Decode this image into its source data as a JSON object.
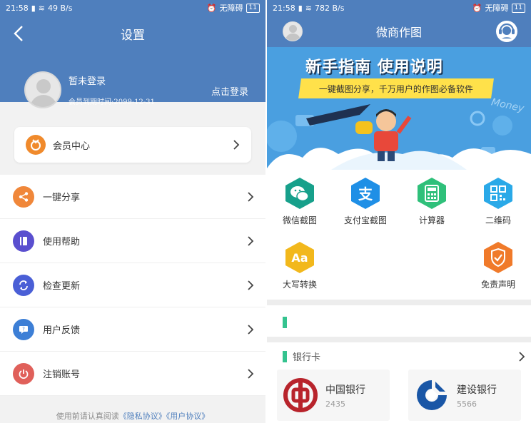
{
  "left": {
    "status": {
      "time": "21:58",
      "speed": "49 B/s",
      "mode": "无障碍",
      "battery": "11"
    },
    "nav": {
      "title": "设置"
    },
    "profile": {
      "name": "暂未登录",
      "expiry": "会员到期时间:2099-12-31",
      "login_link": "点击登录"
    },
    "vip_center": {
      "label": "会员中心"
    },
    "menu": [
      {
        "label": "一键分享",
        "icon": "share-icon",
        "color": "#f0873a"
      },
      {
        "label": "使用帮助",
        "icon": "book-icon",
        "color": "#5a4fcf"
      },
      {
        "label": "检查更新",
        "icon": "refresh-icon",
        "color": "#4a5fd6"
      },
      {
        "label": "用户反馈",
        "icon": "feedback-icon",
        "color": "#3d7fd6"
      },
      {
        "label": "注销账号",
        "icon": "power-icon",
        "color": "#e0605a"
      }
    ],
    "footer": {
      "prefix": "使用前请认真阅读",
      "privacy": "《隐私协议》",
      "user": "《用户协议》"
    }
  },
  "right": {
    "status": {
      "time": "21:58",
      "speed": "782 B/s",
      "mode": "无障碍",
      "battery": "11"
    },
    "header": {
      "title": "微商作图"
    },
    "banner": {
      "title": "新手指南 使用说明",
      "subtitle": "一键截图分享，千万用户的作图必备软件",
      "money": "Money"
    },
    "tools": [
      {
        "label": "微信截图",
        "icon": "wechat-icon",
        "color": "#17a08b"
      },
      {
        "label": "支付宝截图",
        "icon": "alipay-icon",
        "color": "#1f8fe6"
      },
      {
        "label": "计算器",
        "icon": "calculator-icon",
        "color": "#2fc07a"
      },
      {
        "label": "二维码",
        "icon": "qrcode-icon",
        "color": "#2aa9e8"
      },
      {
        "label": "大写转换",
        "icon": "case-convert-icon",
        "color": "#f2b81c",
        "glyph": "Aa"
      },
      {
        "label": "免责声明",
        "icon": "shield-check-icon",
        "color": "#f07a2a"
      }
    ],
    "bank_section": {
      "title": "银行卡",
      "cards": [
        {
          "name": "中国银行",
          "code": "2435",
          "icon": "boc-logo-icon",
          "color": "#b8242c"
        },
        {
          "name": "建设银行",
          "code": "5566",
          "icon": "ccb-logo-icon",
          "color": "#1956a6"
        }
      ]
    },
    "colors": {
      "header": "#4f7fbd",
      "accent": "#34c38f",
      "banner": "#4a9fe0"
    }
  }
}
